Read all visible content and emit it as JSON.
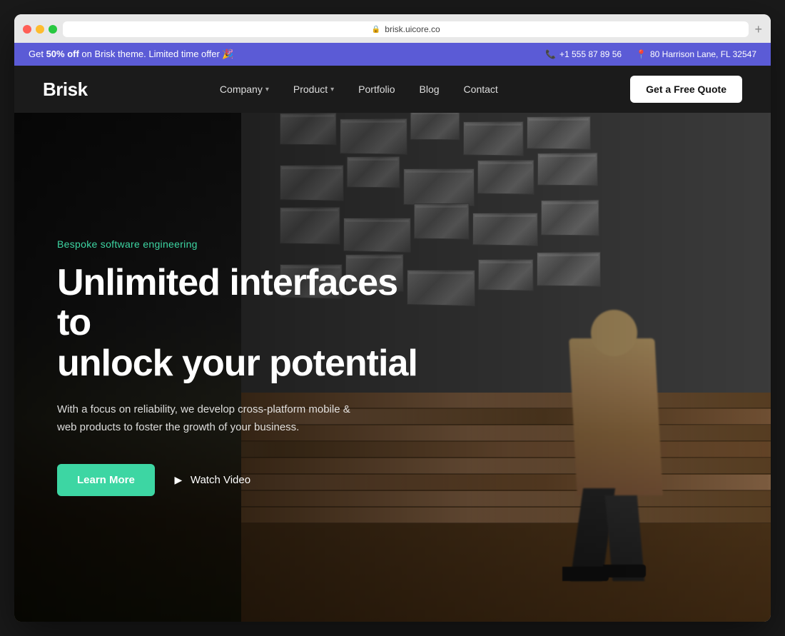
{
  "browser": {
    "url": "brisk.uicore.co",
    "new_tab_label": "+"
  },
  "announcement": {
    "promo": "Get ",
    "promo_bold": "50% off",
    "promo_rest": " on Brisk theme. Limited time offer 🎉",
    "phone_label": "+1 555 87 89 56",
    "address_label": "80 Harrison Lane, FL 32547"
  },
  "navbar": {
    "logo": "Brisk",
    "links": [
      {
        "label": "Company",
        "has_dropdown": true
      },
      {
        "label": "Product",
        "has_dropdown": true
      },
      {
        "label": "Portfolio",
        "has_dropdown": false
      },
      {
        "label": "Blog",
        "has_dropdown": false
      },
      {
        "label": "Contact",
        "has_dropdown": false
      }
    ],
    "cta": "Get a Free Quote"
  },
  "hero": {
    "eyebrow": "Bespoke software engineering",
    "title_line1": "Unlimited interfaces to",
    "title_line2": "unlock your potential",
    "subtitle": "With a focus on reliability, we develop cross-platform mobile & web products to foster the growth of your business.",
    "cta_primary": "Learn More",
    "cta_video": "Watch Video"
  }
}
